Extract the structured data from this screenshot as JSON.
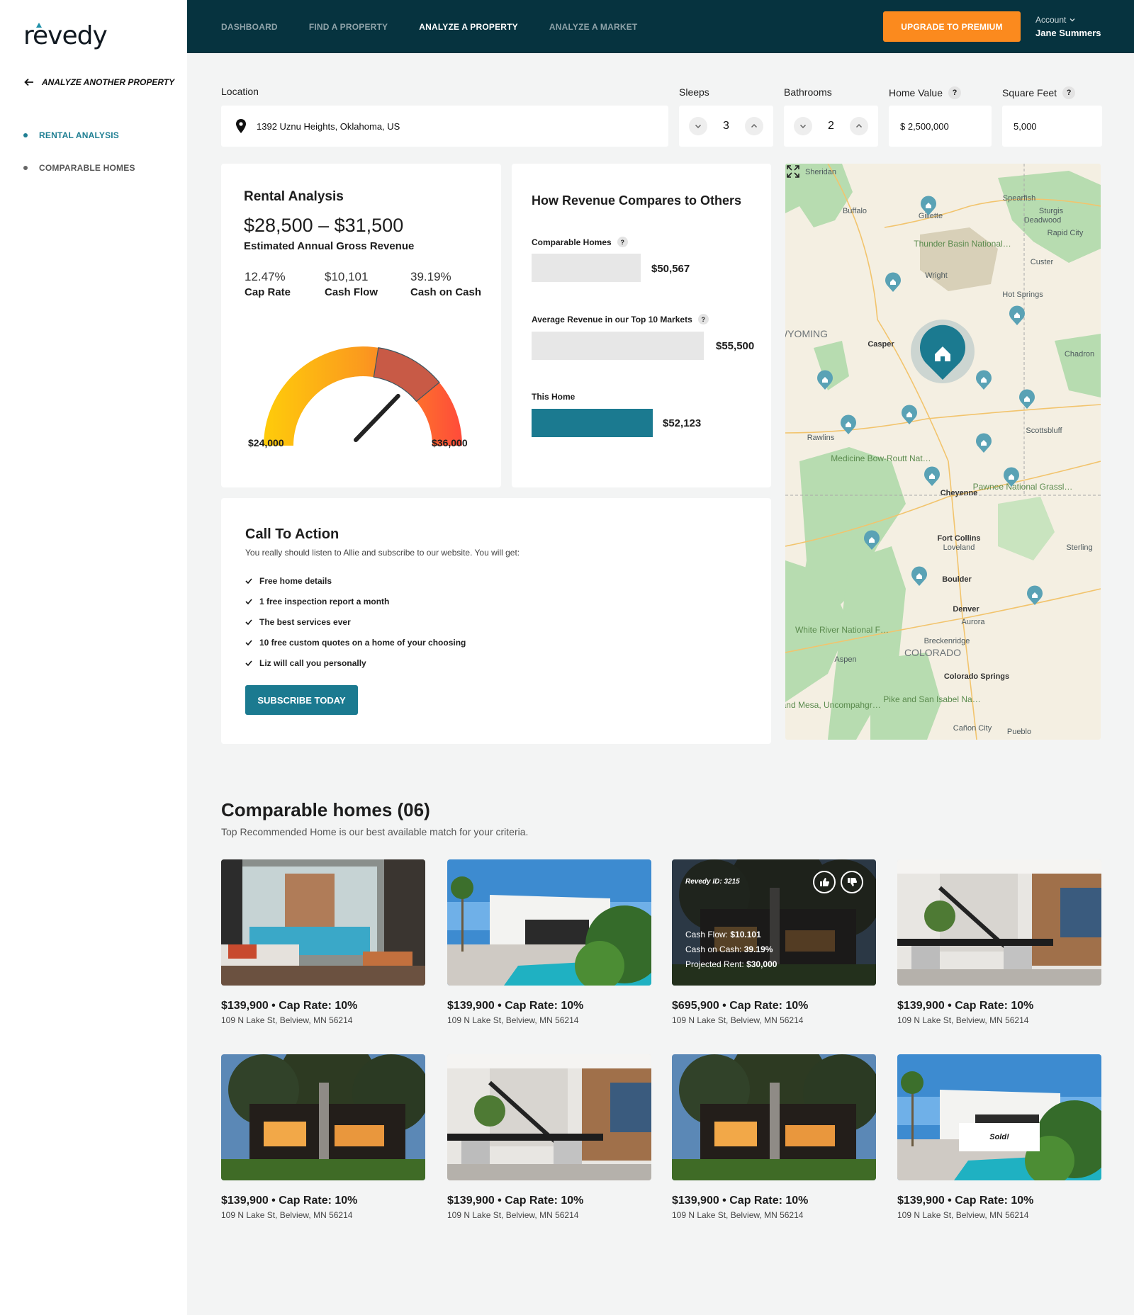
{
  "brand": {
    "logo_text": "revedy",
    "accent": "#1e8fa8"
  },
  "colors": {
    "nav_bg": "#06333f",
    "teal": "#1b7a90",
    "orange": "#fb8a1e"
  },
  "sidebar": {
    "back_label": "ANALYZE ANOTHER PROPERTY",
    "items": [
      {
        "label": "RENTAL ANALYSIS",
        "active": true
      },
      {
        "label": "COMPARABLE HOMES",
        "active": false
      }
    ]
  },
  "topbar": {
    "nav": [
      {
        "label": "DASHBOARD",
        "active": false
      },
      {
        "label": "FIND A PROPERTY",
        "active": false
      },
      {
        "label": "ANALYZE A PROPERTY",
        "active": true
      },
      {
        "label": "ANALYZE A MARKET",
        "active": false
      }
    ],
    "upgrade_label": "UPGRADE TO PREMIUM",
    "account_label": "Account",
    "account_name": "Jane Summers"
  },
  "inputs": {
    "location_label": "Location",
    "location_value": "1392 Uznu Heights, Oklahoma, US",
    "sleeps_label": "Sleeps",
    "sleeps_value": "3",
    "bathrooms_label": "Bathrooms",
    "bathrooms_value": "2",
    "home_value_label": "Home Value",
    "home_value_value": "$ 2,500,000",
    "sqft_label": "Square Feet",
    "sqft_value": "5,000",
    "help": "?"
  },
  "rental_analysis": {
    "title": "Rental Analysis",
    "range": "$28,500  –  $31,500",
    "subtitle": "Estimated Annual Gross Revenue",
    "metrics": [
      {
        "value": "12.47%",
        "label": "Cap Rate"
      },
      {
        "value": "$10,101",
        "label": "Cash Flow"
      },
      {
        "value": "39.19%",
        "label": "Cash on Cash"
      }
    ],
    "gauge_min": "$24,000",
    "gauge_max": "$36,000",
    "gauge_level": 0.62
  },
  "revenue_compare": {
    "title": "How Revenue Compares to Others",
    "rows": [
      {
        "label": "Comparable Homes",
        "value": "$50,567",
        "help": true
      },
      {
        "label": "Average Revenue in our Top 10 Markets",
        "value": "$55,500",
        "help": true
      },
      {
        "label": "This Home",
        "value": "$52,123",
        "help": false
      }
    ]
  },
  "cta": {
    "title": "Call To Action",
    "description": "You really should listen to Allie and subscribe to our website. You will get:",
    "items": [
      "Free home details",
      "1 free inspection report a month",
      "The best services ever",
      "10 free custom quotes on a home of your choosing",
      "Liz will call you personally"
    ],
    "button": "SUBSCRIBE TODAY"
  },
  "map": {
    "labels": [
      "Sheridan",
      "Buffalo",
      "Gillette",
      "Spearfish",
      "Sturgis",
      "Deadwood",
      "Rapid City",
      "Thunder Basin National Grassland",
      "Custer",
      "Wright",
      "Hot Springs",
      "Casper",
      "WYOMING",
      "Chadron",
      "Rawlins",
      "Scottsbluff",
      "Medicine Bow-Routt National Forest",
      "Cheyenne",
      "Pawnee National Grassland",
      "Fort Collins",
      "Loveland",
      "Sterling",
      "Boulder",
      "Denver",
      "Aurora",
      "White River National Forest",
      "Breckenridge",
      "COLORADO",
      "Aspen",
      "Colorado Springs",
      "Pike and San Isabel National Forest",
      "Grand Mesa, Uncompahgre and Gunnison National...",
      "Cañon City",
      "Pueblo"
    ]
  },
  "comparables": {
    "title": "Comparable homes (06)",
    "subtitle": "Top Recommended Home is our best available match for your criteria.",
    "homes": [
      {
        "price": "$139,900",
        "cap": "Cap Rate: 10%",
        "address": "109 N Lake St, Belview, MN 56214"
      },
      {
        "price": "$139,900",
        "cap": "Cap Rate: 10%",
        "address": "109 N Lake St, Belview, MN 56214"
      },
      {
        "price": "$695,900",
        "cap": "Cap Rate: 10%",
        "address": "109 N Lake St, Belview, MN 56214",
        "overlay": {
          "id": "Revedy ID: 3215",
          "cash_flow_label": "Cash Flow:",
          "cash_flow": "$10.101",
          "coc_label": "Cash on Cash:",
          "coc": "39.19%",
          "rent_label": "Projected Rent:",
          "rent": "$30,000"
        }
      },
      {
        "price": "$139,900",
        "cap": "Cap Rate: 10%",
        "address": "109 N Lake St, Belview, MN 56214"
      },
      {
        "price": "$139,900",
        "cap": "Cap Rate: 10%",
        "address": "109 N Lake St, Belview, MN 56214"
      },
      {
        "price": "$139,900",
        "cap": "Cap Rate: 10%",
        "address": "109 N Lake St, Belview, MN 56214"
      },
      {
        "price": "$139,900",
        "cap": "Cap Rate: 10%",
        "address": "109 N Lake St, Belview, MN 56214"
      },
      {
        "price": "$139,900",
        "cap": "Cap Rate: 10%",
        "address": "109 N Lake St, Belview, MN 56214",
        "tag": "Sold!"
      }
    ]
  }
}
